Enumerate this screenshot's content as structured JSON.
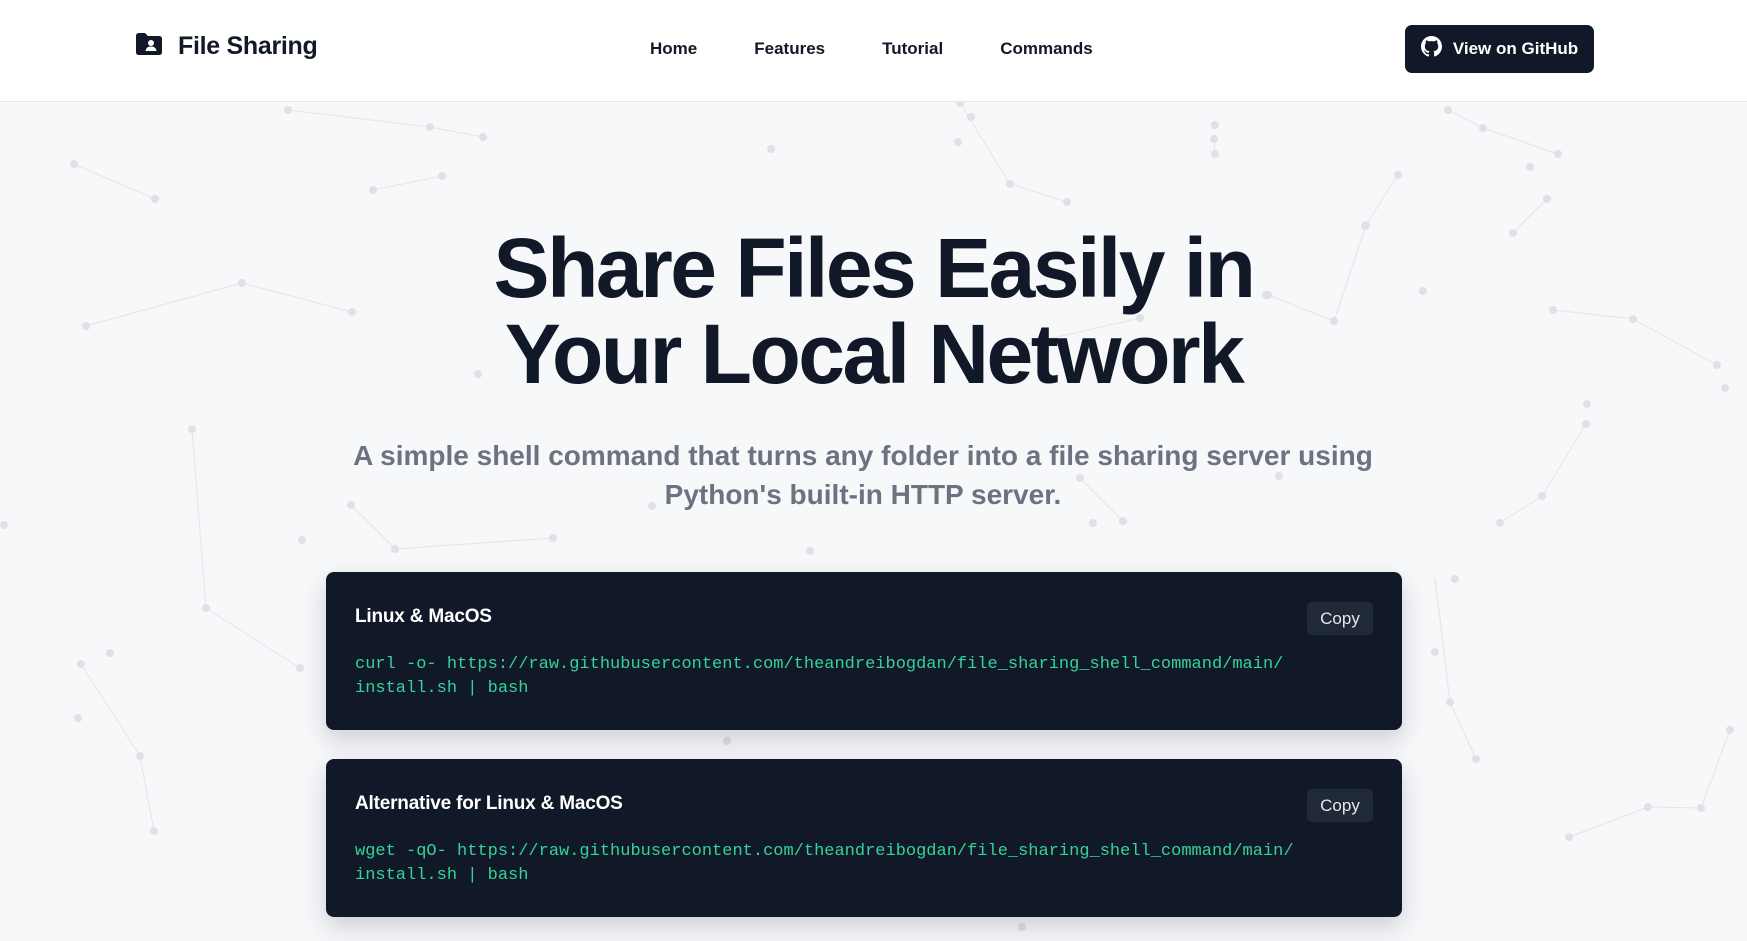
{
  "header": {
    "brand": {
      "icon": "folder-user-icon",
      "title": "File Sharing"
    },
    "nav": [
      {
        "label": "Home"
      },
      {
        "label": "Features"
      },
      {
        "label": "Tutorial"
      },
      {
        "label": "Commands"
      }
    ],
    "github_button": {
      "icon": "github-icon",
      "label": "View on GitHub"
    }
  },
  "hero": {
    "title_line1": "Share Files Easily in",
    "title_line2": "Your Local Network",
    "subtitle": "A simple shell command that turns any folder into a file sharing server using Python's built-in HTTP server."
  },
  "commands": [
    {
      "label": "Linux & MacOS",
      "copy_label": "Copy",
      "code_line1": "curl -o- https://raw.githubusercontent.com/theandreibogdan/file_sharing_shell_command/main/",
      "code_line2": "install.sh | bash"
    },
    {
      "label": "Alternative for Linux & MacOS",
      "copy_label": "Copy",
      "code_line1": "wget -qO- https://raw.githubusercontent.com/theandreibogdan/file_sharing_shell_command/main/",
      "code_line2": "install.sh | bash"
    }
  ],
  "colors": {
    "dark": "#111827",
    "code_green": "#34d399",
    "muted": "#6b7280",
    "background": "#f7f8fa"
  }
}
